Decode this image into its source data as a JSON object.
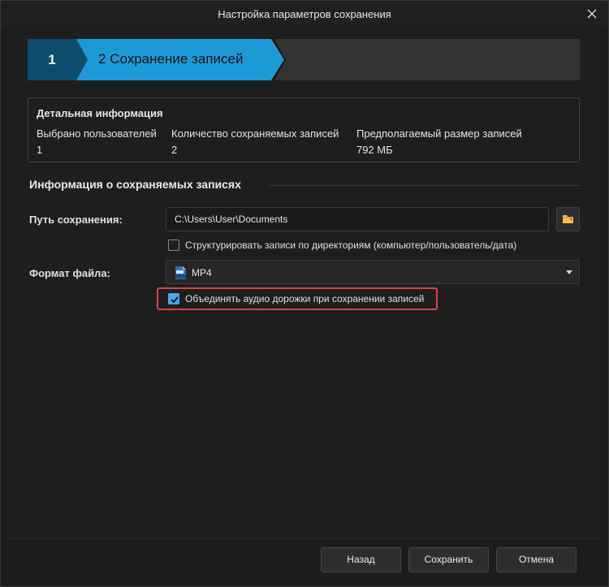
{
  "window": {
    "title": "Настройка параметров сохранения"
  },
  "stepper": {
    "step1_label": "1",
    "step2_label": "2 Сохранение записей",
    "active_color": "#1d9ad6",
    "inactive_color": "#0f4d6e"
  },
  "details": {
    "title": "Детальная информация",
    "columns": [
      {
        "label": "Выбрано пользователей",
        "value": "1"
      },
      {
        "label": "Количество сохраняемых записей",
        "value": "2"
      },
      {
        "label": "Предполагаемый размер записей",
        "value": "792 МБ"
      }
    ]
  },
  "section": {
    "title": "Информация о сохраняемых записях",
    "path_label": "Путь сохранения:",
    "path_value": "C:\\Users\\User\\Documents",
    "structure_checkbox": {
      "label": "Структурировать записи по директориям (компьютер/пользователь/дата)",
      "checked": false
    },
    "format_label": "Формат файла:",
    "format_value": "MP4",
    "merge_audio_checkbox": {
      "label": "Объединять аудио дорожки при сохранении записей",
      "checked": true
    },
    "highlight_color": "#e0404a"
  },
  "buttons": {
    "back": "Назад",
    "save": "Сохранить",
    "cancel": "Отмена"
  },
  "icons": {
    "close": "close-icon",
    "folder": "folder-icon",
    "format": "mp4-file-icon",
    "dropdown": "chevron-down-icon",
    "check": "checkmark-icon"
  }
}
